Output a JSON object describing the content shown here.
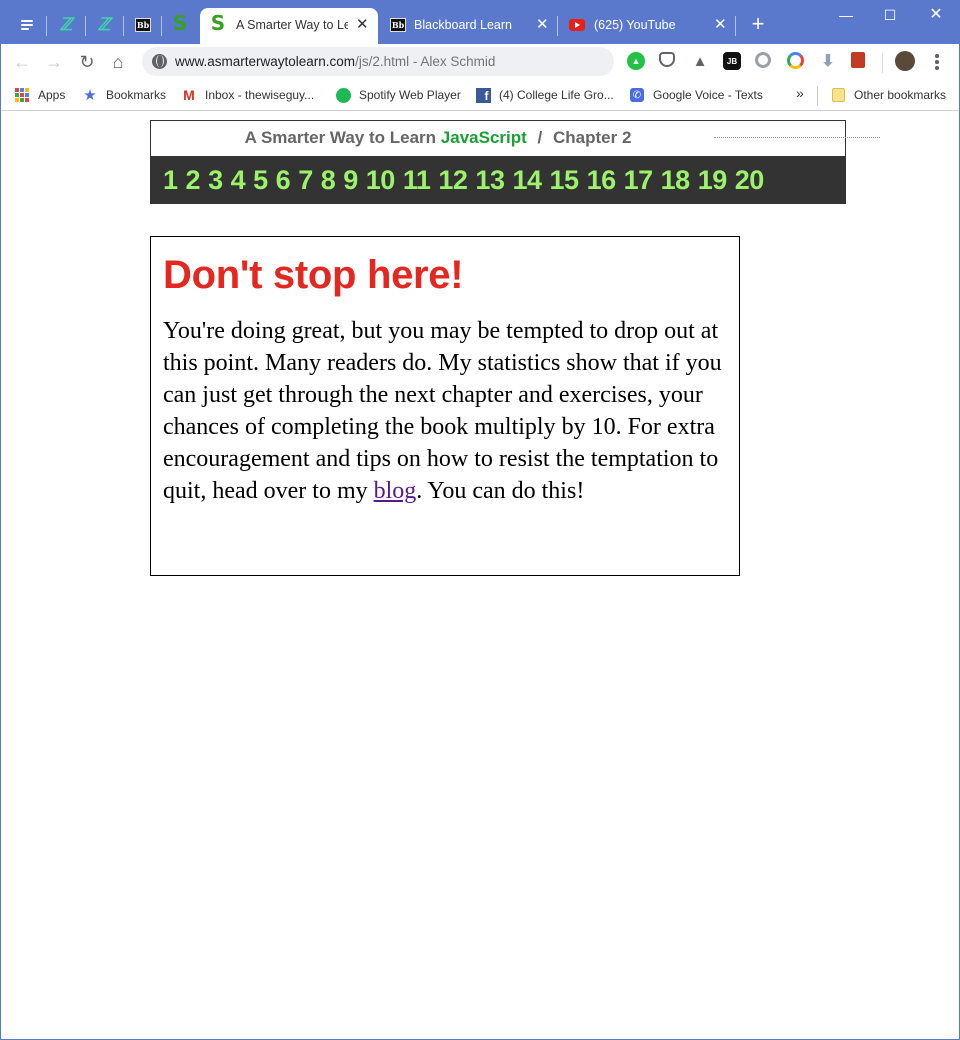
{
  "browser": {
    "tabs": [
      {
        "label": "",
        "icon": "dev-icon"
      },
      {
        "label": "",
        "icon": "dev-icon"
      },
      {
        "label": "",
        "icon": "blackboard-icon"
      },
      {
        "label": "",
        "icon": "s-icon"
      },
      {
        "label": "A Smarter Way to Lea",
        "icon": "s-icon",
        "active": true
      },
      {
        "label": "Blackboard Learn",
        "icon": "blackboard-icon"
      },
      {
        "label": "(625) YouTube",
        "icon": "youtube-icon"
      }
    ],
    "url_host": "www.asmarterwaytolearn.com",
    "url_path": "/js/2.html - Alex Schmid",
    "bookmarks": [
      {
        "label": "Apps",
        "icon": "apps-grid-icon"
      },
      {
        "label": "Bookmarks",
        "icon": "star-icon"
      },
      {
        "label": "Inbox - thewiseguy...",
        "icon": "gmail-icon"
      },
      {
        "label": "Spotify Web Player",
        "icon": "spotify-icon"
      },
      {
        "label": "(4) College Life Gro...",
        "icon": "facebook-icon"
      },
      {
        "label": "Google Voice - Texts",
        "icon": "google-voice-icon"
      }
    ],
    "other_bookmarks": "Other bookmarks",
    "overflow": "»"
  },
  "header": {
    "title_prefix": "A Smarter Way to Learn",
    "title_subject": "JavaScript",
    "title_sep": "/",
    "title_chapter": "Chapter 2",
    "chapters": [
      "1",
      "2",
      "3",
      "4",
      "5",
      "6",
      "7",
      "8",
      "9",
      "10",
      "11",
      "12",
      "13",
      "14",
      "15",
      "16",
      "17",
      "18",
      "19",
      "20"
    ]
  },
  "notice": {
    "heading": "Don't stop here!",
    "body_before": "You're doing great, but you may be tempted to drop out at this point. Many readers do. My statistics show that if you can just get through the next chapter and exercises, your chances of completing the book multiply by 10. For extra encouragement and tips on how to resist the temptation to quit, head over to my",
    "link": "blog",
    "body_after": ". You can do this!"
  },
  "colors": {
    "titlebar": "#5b79cc",
    "heading_red": "#e4271f",
    "chapter_green": "#9cf26a",
    "subject_green": "#1aa033",
    "nav_bg": "#333333",
    "link": "#551a8b"
  }
}
